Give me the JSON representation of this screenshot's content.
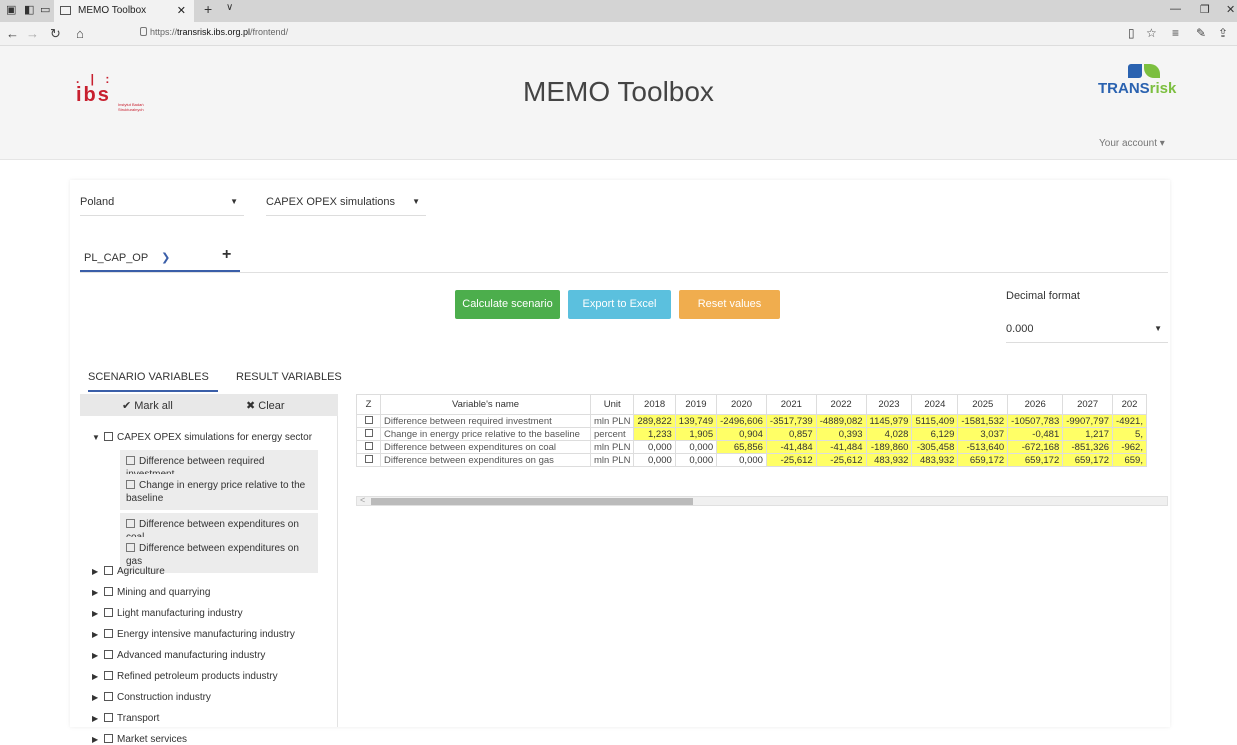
{
  "browser": {
    "tab_title": "MEMO Toolbox",
    "url_prefix": "https://",
    "url_host": "transrisk.ibs.org.pl",
    "url_path": "/frontend/"
  },
  "header": {
    "title": "MEMO Toolbox",
    "ibs_logo": "ibs",
    "ibs_subtitle": "Instytut Badań Strukturalnych",
    "partner_logo_a": "TRANS",
    "partner_logo_b": "risk",
    "account_menu": "Your account ▾"
  },
  "filters": {
    "country": "Poland",
    "simulation": "CAPEX OPEX simulations"
  },
  "scenario_tab": {
    "label": "PL_CAP_OP",
    "add": "+"
  },
  "actions": {
    "calculate": "Calculate scenario",
    "export": "Export to Excel",
    "reset": "Reset values",
    "accent_green": "#4cae4c",
    "accent_blue": "#5bc0de",
    "accent_orange": "#f0ad4e"
  },
  "decimal": {
    "label": "Decimal format",
    "value": "0.000"
  },
  "variable_tabs": {
    "scenario": "SCENARIO VARIABLES",
    "result": "RESULT VARIABLES"
  },
  "tree": {
    "mark_all": "✔ Mark all",
    "clear": "✖ Clear",
    "root": "CAPEX OPEX simulations for energy sector",
    "children": [
      "Difference between required investment",
      "Change in energy price relative to the baseline",
      "Difference between expenditures on coal",
      "Difference between expenditures on gas"
    ],
    "sectors": [
      "Agriculture",
      "Mining and quarrying",
      "Light manufacturing industry",
      "Energy intensive manufacturing industry",
      "Advanced manufacturing industry",
      "Refined petroleum products industry",
      "Construction industry",
      "Transport",
      "Market services"
    ]
  },
  "table": {
    "headers": [
      "Z",
      "Variable's name",
      "Unit",
      "2018",
      "2019",
      "2020",
      "2021",
      "2022",
      "2023",
      "2024",
      "2025",
      "2026",
      "2027",
      "202"
    ],
    "rows": [
      {
        "name": "Difference between required investment",
        "unit": "mln PLN",
        "values": [
          "289,822",
          "139,749",
          "-2496,606",
          "-3517,739",
          "-4889,082",
          "1145,979",
          "5115,409",
          "-1581,532",
          "-10507,783",
          "-9907,797",
          "-4921,"
        ]
      },
      {
        "name": "Change in energy price relative to the baseline",
        "unit": "percent",
        "values": [
          "1,233",
          "1,905",
          "0,904",
          "0,857",
          "0,393",
          "4,028",
          "6,129",
          "3,037",
          "-0,481",
          "1,217",
          "5,"
        ]
      },
      {
        "name": "Difference between expenditures on coal",
        "unit": "mln PLN",
        "values": [
          "0,000",
          "0,000",
          "65,856",
          "-41,484",
          "-41,484",
          "-189,860",
          "-305,458",
          "-513,640",
          "-672,168",
          "-851,326",
          "-962,"
        ]
      },
      {
        "name": "Difference between expenditures on gas",
        "unit": "mln PLN",
        "values": [
          "0,000",
          "0,000",
          "0,000",
          "-25,612",
          "-25,612",
          "483,932",
          "483,932",
          "659,172",
          "659,172",
          "659,172",
          "659,"
        ]
      }
    ],
    "highlight_color": "#ffff66"
  }
}
